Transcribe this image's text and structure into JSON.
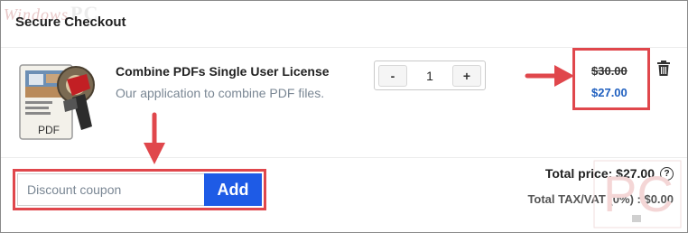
{
  "watermark": {
    "script": "Windows",
    "letters": "PC",
    "bottom_letters": "PC"
  },
  "header": {
    "title": "Secure Checkout"
  },
  "product": {
    "image_label": "PDF",
    "name": "Combine PDFs Single User License",
    "description": "Our application to combine PDF files.",
    "quantity": "1",
    "decrement_label": "-",
    "increment_label": "+",
    "old_price": "$30.00",
    "new_price": "$27.00",
    "delete_icon": "trash-icon"
  },
  "coupon": {
    "placeholder": "Discount coupon",
    "value": "",
    "add_label": "Add"
  },
  "totals": {
    "total_price": "Total price: $27.00",
    "help_icon_glyph": "?",
    "tax": "Total TAX/VAT (0%) : $0.00"
  },
  "colors": {
    "accent_blue": "#1e5be6",
    "price_blue": "#1f5fbf",
    "highlight_red": "#e0474c",
    "muted_text": "#7a8794"
  }
}
